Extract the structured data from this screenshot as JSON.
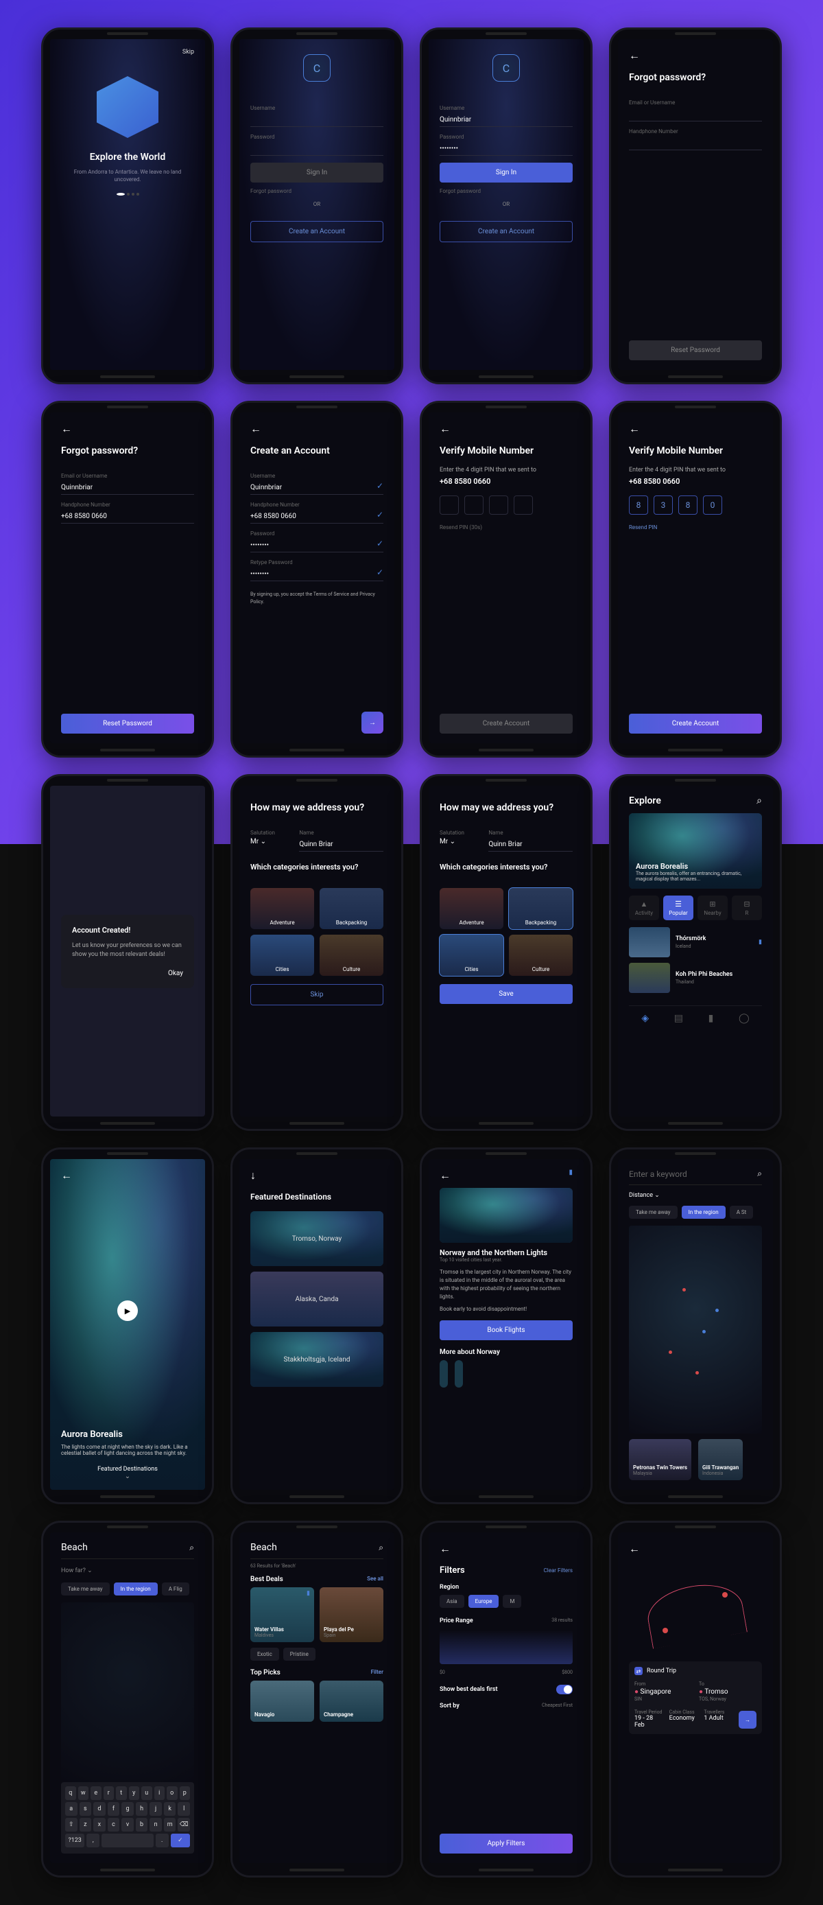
{
  "s1": {
    "skip": "Skip",
    "title": "Explore the World",
    "sub": "From Andorra to Antartica.\nWe leave no land uncovered."
  },
  "s2": {
    "logo": "C",
    "uL": "Username",
    "pL": "Password",
    "signin": "Sign In",
    "forgot": "Forgot password",
    "or": "OR",
    "create": "Create an Account"
  },
  "s3": {
    "logo": "C",
    "uL": "Username",
    "uV": "Quinnbriar",
    "pL": "Password",
    "pV": "••••••••",
    "signin": "Sign In",
    "forgot": "Forgot password",
    "or": "OR",
    "create": "Create an Account"
  },
  "s4": {
    "title": "Forgot password?",
    "l1": "Email or Username",
    "l2": "Handphone Number",
    "btn": "Reset Password"
  },
  "s5": {
    "title": "Forgot password?",
    "l1": "Email or Username",
    "v1": "Quinnbriar",
    "l2": "Handphone Number",
    "v2": "+68 8580 0660",
    "btn": "Reset Password"
  },
  "s6": {
    "title": "Create an Account",
    "uL": "Username",
    "uV": "Quinnbriar",
    "hL": "Handphone Number",
    "hV": "+68 8580 0660",
    "pL": "Password",
    "pV": "••••••••",
    "rL": "Retype Password",
    "rV": "••••••••",
    "terms": "By signing up, you accept the Terms of Service and Privacy Policy."
  },
  "s7": {
    "title": "Verify Mobile Number",
    "sub": "Enter the 4 digit PIN that we sent to",
    "num": "+68 8580 0660",
    "resend": "Resend PIN (30s)",
    "btn": "Create Account"
  },
  "s8": {
    "title": "Verify Mobile Number",
    "sub": "Enter the 4 digit PIN that we sent to",
    "num": "+68 8580 0660",
    "pin": [
      "8",
      "3",
      "8",
      "0"
    ],
    "resend": "Resend PIN",
    "btn": "Create Account"
  },
  "s9": {
    "title": "Account Created!",
    "body": "Let us know your preferences so we can show you the most relevant deals!",
    "ok": "Okay"
  },
  "s10": {
    "q1": "How may we address you?",
    "salL": "Salutation",
    "salV": "Mr",
    "nameL": "Name",
    "nameV": "Quinn Briar",
    "q2": "Which categories interests you?",
    "cats": [
      "Adventure",
      "Backpacking",
      "Cities",
      "Culture"
    ],
    "btn": "Skip"
  },
  "s11": {
    "q1": "How may we address you?",
    "salL": "Salutation",
    "salV": "Mr",
    "nameL": "Name",
    "nameV": "Quinn Briar",
    "q2": "Which categories interests you?",
    "cats": [
      "Adventure",
      "Backpacking",
      "Cities",
      "Culture"
    ],
    "btn": "Save"
  },
  "s12": {
    "title": "Explore",
    "heroT": "Aurora Borealis",
    "heroS": "The aurora borealis, offer an entrancing, dramatic, magical display that amazes...",
    "tabs": [
      "Activity",
      "Popular",
      "Nearby",
      "R"
    ],
    "item1": "Thórsmörk",
    "item1s": "Iceland",
    "item2": "Koh Phi Phi Beaches",
    "item2s": "Thailand"
  },
  "s13": {
    "title": "Aurora Borealis",
    "body": "The lights come at night when the sky is dark. Like a celestial ballet of light dancing across the night sky.",
    "link": "Featured Destinations"
  },
  "s14": {
    "title": "Featured Destinations",
    "d1": "Tromso, Norway",
    "d2": "Alaska, Canda",
    "d3": "Stakkholtsgja, Iceland"
  },
  "s15": {
    "title": "Norway and the Northern Lights",
    "sub": "Top 10 visited cities last year.",
    "p1": "Tromsø is the largest city in Northern Norway. The city is situated in the middle of the auroral oval, the area with the highest probability of seeing the northern lights.",
    "p2": "Book early to avoid disappointment!",
    "btn": "Book Flights",
    "more": "More about Norway"
  },
  "s16": {
    "ph": "Enter a keyword",
    "dist": "Distance",
    "p1": "Take me away",
    "p2": "In the region",
    "p3": "A St",
    "c1": "Petronas Twin Towers",
    "c1s": "Malaysia",
    "c2": "Gili Trawangan",
    "c2s": "Indonesia"
  },
  "s17": {
    "q": "Beach",
    "far": "How far?",
    "p1": "Take me away",
    "p2": "In the region",
    "p3": "A Flig",
    "krows": [
      [
        "q",
        "w",
        "e",
        "r",
        "t",
        "y",
        "u",
        "i",
        "o",
        "p"
      ],
      [
        "a",
        "s",
        "d",
        "f",
        "g",
        "h",
        "j",
        "k",
        "l"
      ],
      [
        "⇧",
        "z",
        "x",
        "c",
        "v",
        "b",
        "n",
        "m",
        "⌫"
      ],
      [
        "?123",
        ",",
        "",
        "␣",
        "",
        ".",
        "✓"
      ]
    ]
  },
  "s18": {
    "q": "Beach",
    "res": "63 Results for 'Beach'",
    "sec1": "Best Deals",
    "see": "See all",
    "c1": "Water Villas",
    "c1s": "Maldives",
    "c2": "Playa del Pe",
    "c2s": "Spain",
    "t1": "Exotic",
    "t2": "Pristine",
    "sec2": "Top Picks",
    "filt": "Filter",
    "c3": "Navagio",
    "c4": "Champagne"
  },
  "s19": {
    "title": "Filters",
    "clear": "Clear Filters",
    "reg": "Region",
    "r1": "Asia",
    "r2": "Europe",
    "r3": "M",
    "pr": "Price Range",
    "cnt": "38 results",
    "lo": "$0",
    "hi": "$800",
    "best": "Show best deals first",
    "sort": "Sort by",
    "sv": "Cheapest First",
    "btn": "Apply Filters"
  },
  "s20": {
    "trip": "Round Trip",
    "fL": "From",
    "fV": "Singapore",
    "fC": "SIN",
    "tL": "To",
    "tV": "Tromso",
    "tC": "TOS, Norway",
    "tpL": "Travel Period",
    "tpV": "19 - 28 Feb",
    "ccL": "Cabin Class",
    "ccV": "Economy",
    "trL": "Travellers",
    "trV": "1 Adult"
  }
}
